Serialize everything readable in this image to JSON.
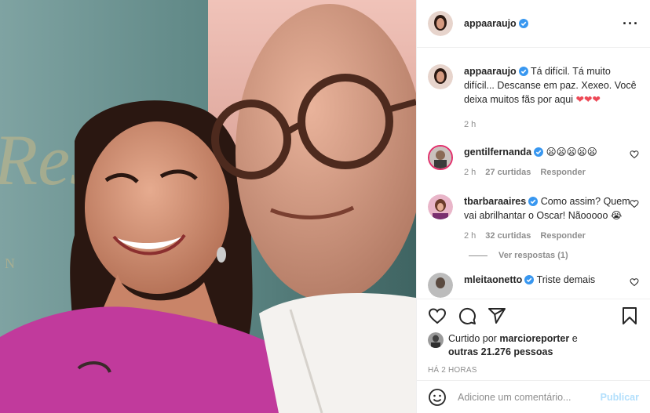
{
  "author": {
    "username": "appaaraujo",
    "verified": true,
    "avatar": "user-avatar"
  },
  "caption": {
    "text": "Tá difícil. Tá muito difícil... Descanse em paz. Xexeo. Você deixa muitos fãs por aqui",
    "emoji": "❤❤❤",
    "time": "2 h"
  },
  "comments": [
    {
      "username": "gentilfernanda",
      "text": "😦😦😦😦😦",
      "time": "2 h",
      "likes": "27 curtidas",
      "reply": "Responder"
    },
    {
      "username": "tbarbaraaires",
      "text": "Como assim? Quem vai abrilhantar o Oscar! Nãooooo 😭",
      "time": "2 h",
      "likes": "32 curtidas",
      "reply": "Responder",
      "view_replies": "Ver respostas (1)"
    },
    {
      "username": "mleitaonetto",
      "text": "Triste demais"
    }
  ],
  "likes": {
    "prefix": "Curtido por",
    "user": "marcioreporter",
    "and": "e",
    "others": "outras 21.276 pessoas"
  },
  "posted": "HÁ 2 HORAS",
  "composer": {
    "placeholder": "Adicione um comentário...",
    "publish": "Publicar"
  },
  "colors": {
    "verified": "#3897f0",
    "heart": "#ed4956",
    "publish_disabled": "#b2dffc",
    "secondary_text": "#8e8e8e"
  },
  "icons": [
    "heart-icon",
    "comment-icon",
    "share-icon",
    "bookmark-icon",
    "emoji-icon",
    "more-options-icon",
    "verified-badge-icon",
    "like-comment-icon"
  ]
}
